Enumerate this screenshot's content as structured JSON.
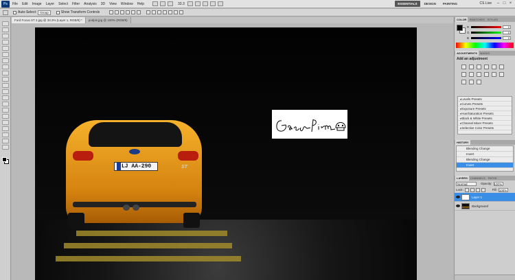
{
  "app": {
    "logo": "Ps"
  },
  "menu": [
    "File",
    "Edit",
    "Image",
    "Layer",
    "Select",
    "Filter",
    "Analysis",
    "3D",
    "View",
    "Window",
    "Help"
  ],
  "menubar": {
    "zoom": "33.3"
  },
  "workspaces": [
    "ESSENTIALS",
    "DESIGN",
    "PAINTING"
  ],
  "cs_live": "CS Live",
  "options": {
    "auto_select": "Auto-Select:",
    "auto_select_value": "Group",
    "show_transform": "Show Transform Controls"
  },
  "tabs": [
    {
      "label": "Ford Focus ST 2.jpg @ 33.3% (Layer 1, RGB/8) *"
    },
    {
      "label": "podpis.jpg @ 100% (RGB/8)"
    }
  ],
  "canvas": {
    "plate": "LJ AA-290",
    "badge": "ST"
  },
  "panels": {
    "color_tabs": [
      "COLOR",
      "SWATCHES",
      "STYLES"
    ],
    "rgb": [
      {
        "label": "R",
        "value": "0"
      },
      {
        "label": "G",
        "value": "0"
      },
      {
        "label": "B",
        "value": "0"
      }
    ],
    "adjust_tabs": [
      "ADJUSTMENTS",
      "MASKS"
    ],
    "adjust_title": "Add an adjustment",
    "presets": [
      "Levels Presets",
      "Curves Presets",
      "Exposure Presets",
      "Hue/Saturation Presets",
      "Black & White Presets",
      "Channel Mixer Presets",
      "Selective Color Presets"
    ],
    "history_tabs": [
      "HISTORY"
    ],
    "history": [
      "Blending Change",
      "Invert",
      "Blending Change",
      "Invert"
    ],
    "layers_tabs": [
      "LAYERS",
      "CHANNELS",
      "PATHS"
    ],
    "blend_mode": "Normal",
    "opacity_label": "Opacity:",
    "opacity": "100%",
    "lock_label": "Lock:",
    "fill_label": "Fill:",
    "fill": "100%",
    "layers": [
      {
        "name": "Layer 1",
        "active": true
      },
      {
        "name": "Background",
        "active": false
      }
    ]
  },
  "colors": {
    "accent": "#3a8ee6",
    "car": "#f6b12b",
    "plate_eu": "#1b3c9a"
  }
}
